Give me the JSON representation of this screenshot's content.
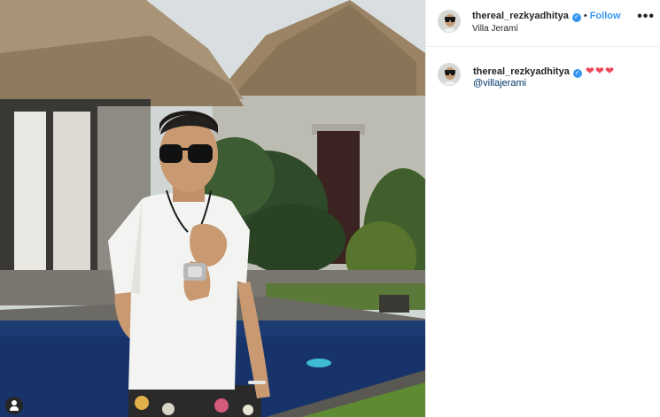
{
  "post": {
    "photo_icon": "photo-scene",
    "tag_icon": "user-tag-icon"
  },
  "header": {
    "username": "thereal_rezkyadhitya",
    "verified_icon": "verified-badge-icon",
    "separator": "•",
    "follow_label": "Follow",
    "location": "Villa Jeramí",
    "more_icon": "more-options-icon",
    "more_label": "•••"
  },
  "comment": {
    "username": "thereal_rezkyadhitya",
    "hearts": "❤❤❤",
    "mention": "@villajerami"
  },
  "colors": {
    "link_blue": "#3897f0",
    "mention_blue": "#003569",
    "heart_red": "#ed4956",
    "text": "#262626"
  }
}
